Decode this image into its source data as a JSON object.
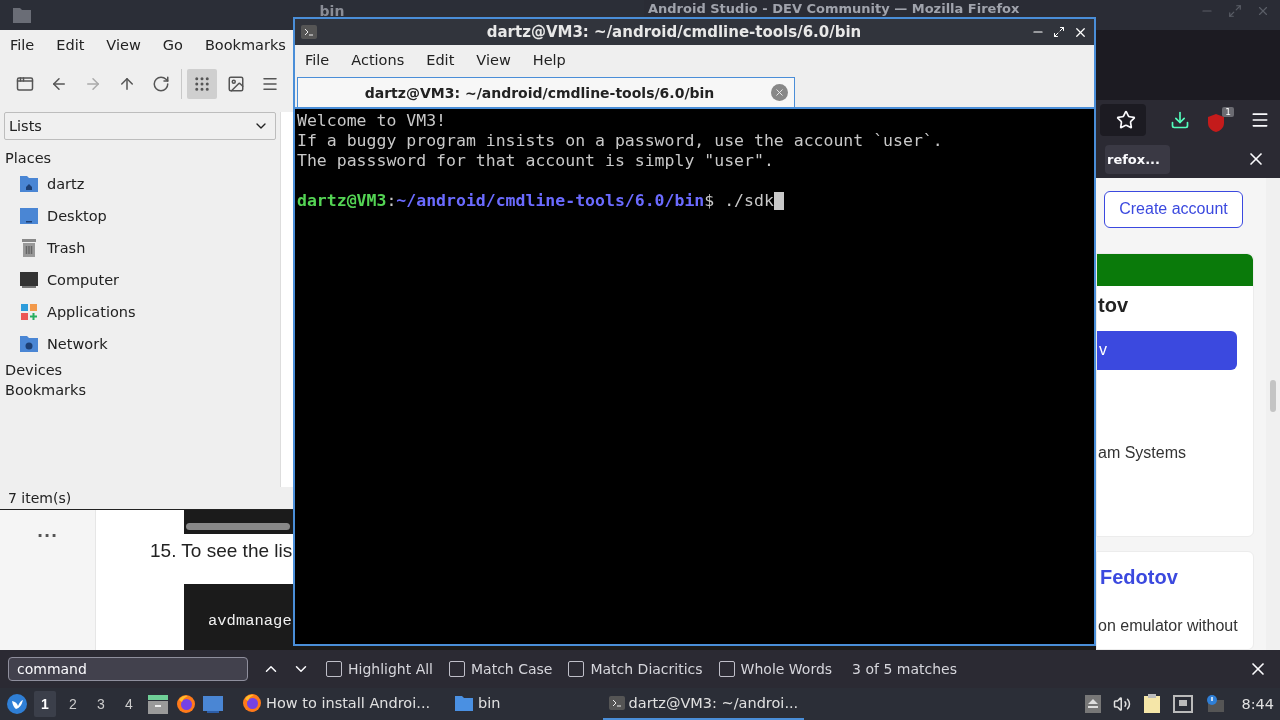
{
  "firefox": {
    "title": "Android Studio - DEV Community — Mozilla Firefox",
    "addon_badge": "1",
    "notification": {
      "label": "refox..."
    },
    "page": {
      "more": "...",
      "step": "15. To see the lis",
      "code": "avdmanage",
      "create_account": "Create account",
      "card_heading": "tov",
      "card_button": "v",
      "card_text": "am Systems",
      "article_title": "Fedotov",
      "article_text": "on emulator without"
    },
    "find_bar": {
      "value": "command",
      "options": [
        {
          "label": "Highlight All",
          "checked": false
        },
        {
          "label": "Match Case",
          "checked": false
        },
        {
          "label": "Match Diacritics",
          "checked": false
        },
        {
          "label": "Whole Words",
          "checked": false
        }
      ],
      "status": "3 of 5 matches"
    }
  },
  "file_manager": {
    "title": "bin",
    "menu": [
      "File",
      "Edit",
      "View",
      "Go",
      "Bookmarks"
    ],
    "view_modes": [
      {
        "kind": "icons",
        "selected": true
      },
      {
        "kind": "thumbnails",
        "selected": false
      },
      {
        "kind": "details",
        "selected": false
      }
    ],
    "pane_selector": "Lists",
    "sections": [
      {
        "label": "Places",
        "items": [
          {
            "label": "dartz",
            "kind": "home"
          },
          {
            "label": "Desktop",
            "kind": "desktop"
          },
          {
            "label": "Trash",
            "kind": "trash"
          },
          {
            "label": "Computer",
            "kind": "computer"
          },
          {
            "label": "Applications",
            "kind": "applications"
          },
          {
            "label": "Network",
            "kind": "network"
          }
        ]
      },
      {
        "label": "Devices"
      },
      {
        "label": "Bookmarks"
      }
    ],
    "status": "7 item(s)"
  },
  "terminal": {
    "title": "dartz@VM3: ~/android/cmdline-tools/6.0/bin",
    "menu": [
      "File",
      "Actions",
      "Edit",
      "View",
      "Help"
    ],
    "tabs": [
      {
        "title": "dartz@VM3: ~/android/cmdline-tools/6.0/bin",
        "selected": true
      }
    ],
    "lines": [
      "Welcome to VM3!",
      "If a buggy program insists on a password, use the account `user`.",
      "The passsword for that account is simply \"user\"."
    ],
    "prompt": {
      "user_host": "dartz@VM3",
      "separator": ":",
      "path": "~/android/cmdline-tools/6.0/bin",
      "command": "$ ./sdk"
    }
  },
  "taskbar": {
    "workspaces": [
      {
        "label": "1",
        "selected": true
      },
      {
        "label": "2",
        "selected": false
      },
      {
        "label": "3",
        "selected": false
      },
      {
        "label": "4",
        "selected": false
      }
    ],
    "launchers": [
      {
        "kind": "files"
      },
      {
        "kind": "firefox"
      },
      {
        "kind": "desktop"
      }
    ],
    "tasks": [
      {
        "label": "How to install Androi...",
        "kind": "firefox",
        "selected": false
      },
      {
        "label": "bin",
        "kind": "folder",
        "selected": false
      },
      {
        "label": "dartz@VM3: ~/androi...",
        "kind": "terminal",
        "selected": true
      }
    ],
    "clock": "8:44"
  }
}
